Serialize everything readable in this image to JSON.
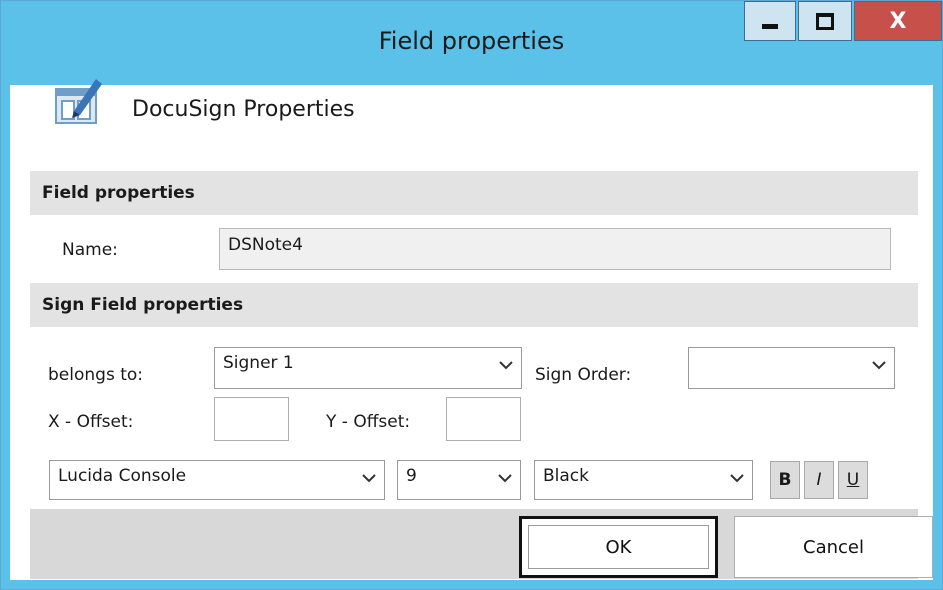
{
  "window": {
    "title": "Field properties",
    "minimize_icon": "minimize-icon",
    "maximize_icon": "maximize-icon",
    "close_label": "X"
  },
  "header": {
    "icon": "docusign-form-edit-icon",
    "title": "DocuSign Properties"
  },
  "field_properties": {
    "section_title": "Field properties",
    "name_label": "Name:",
    "name_value": "DSNote4"
  },
  "sign_field_properties": {
    "section_title": "Sign Field properties",
    "belongs_to_label": "belongs to:",
    "belongs_to_value": "Signer 1",
    "sign_order_label": "Sign Order:",
    "sign_order_value": "",
    "x_offset_label": "X - Offset:",
    "x_offset_value": "",
    "y_offset_label": "Y - Offset:",
    "y_offset_value": "",
    "font_value": "Lucida Console",
    "font_size_value": "9",
    "color_value": "Black",
    "bold_label": "B",
    "italic_label": "I",
    "underline_label": "U"
  },
  "footer": {
    "ok_label": "OK",
    "cancel_label": "Cancel"
  },
  "colors": {
    "title_bar": "#5bc1e8",
    "close_button": "#c7504a",
    "section_bg": "#e3e3e3",
    "footer_bg": "#d8d8d8"
  }
}
